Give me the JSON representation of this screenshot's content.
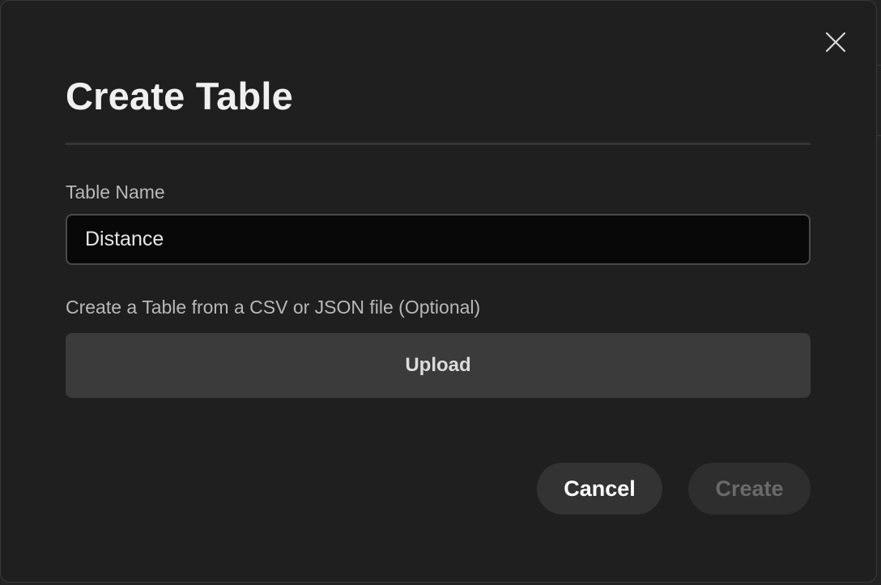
{
  "dialog": {
    "title": "Create Table",
    "close_icon": "close-icon",
    "table_name": {
      "label": "Table Name",
      "value": "Distance"
    },
    "upload": {
      "label": "Create a Table from a CSV or JSON file (Optional)",
      "button_label": "Upload"
    },
    "actions": {
      "cancel_label": "Cancel",
      "create_label": "Create",
      "create_disabled": true
    }
  },
  "colors": {
    "background": "#1f1f1f",
    "input_background": "#080808",
    "upload_button": "#3b3b3b",
    "cancel_button": "#333333",
    "create_button_disabled": "#2e2e2e",
    "create_text_disabled": "#6a6a6a"
  }
}
